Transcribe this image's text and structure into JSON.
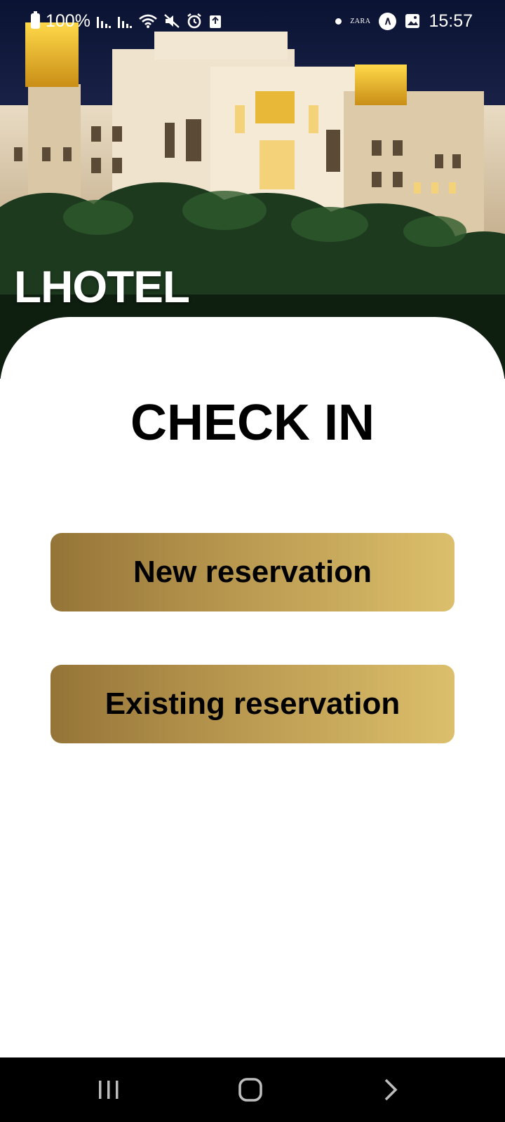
{
  "status_bar": {
    "battery": "100%",
    "time": "15:57",
    "notification_app": "ZARA"
  },
  "brand": "LHOTEL",
  "main": {
    "title": "CHECK IN",
    "buttons": {
      "new_reservation": "New reservation",
      "existing_reservation": "Existing reservation"
    }
  },
  "colors": {
    "button_gradient_start": "#957438",
    "button_gradient_end": "#dcbf6c",
    "card_background": "#ffffff",
    "nav_background": "#000000"
  },
  "icons": {
    "status": [
      "battery-icon",
      "signal-icon",
      "signal-icon",
      "wifi-icon",
      "mute-icon",
      "alarm-icon",
      "upload-icon",
      "dot-icon",
      "zara-icon",
      "circle-a-icon",
      "gallery-icon"
    ],
    "navigation": [
      "recent-apps-icon",
      "home-icon",
      "back-icon"
    ]
  }
}
